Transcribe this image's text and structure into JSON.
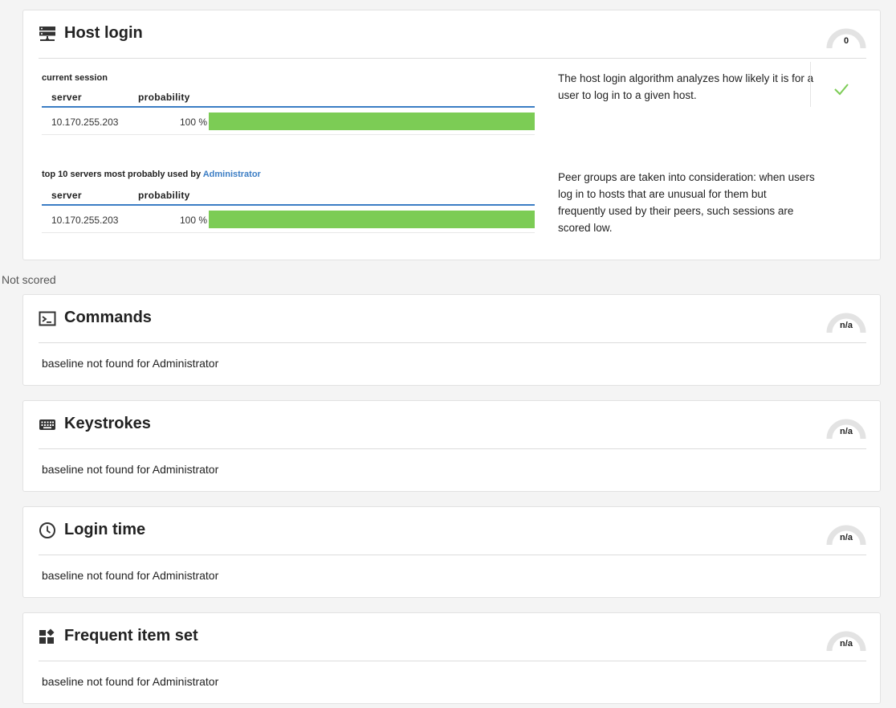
{
  "host_login": {
    "title": "Host login",
    "icon": "server-icon",
    "score": "0",
    "current_session": {
      "label": "current session",
      "columns": [
        "server",
        "probability"
      ],
      "rows": [
        {
          "server": "10.170.255.203",
          "probability": "100 %",
          "fill": 1.0
        }
      ]
    },
    "top_servers": {
      "label_prefix": "top 10 servers most probably used by ",
      "user": "Administrator",
      "columns": [
        "server",
        "probability"
      ],
      "rows": [
        {
          "server": "10.170.255.203",
          "probability": "100 %",
          "fill": 1.0
        }
      ]
    },
    "description_1": "The host login algorithm analyzes how likely it is for a user to log in to a given host.",
    "description_2": "Peer groups are taken into consideration: when users log in to hosts that are unusual for them but frequently used by their peers, such sessions are scored low.",
    "status_icon": "check-icon"
  },
  "section_label": "Not scored",
  "unscored_cards": [
    {
      "title": "Commands",
      "icon": "terminal-icon",
      "score": "n/a",
      "message": "baseline not found for Administrator"
    },
    {
      "title": "Keystrokes",
      "icon": "keyboard-icon",
      "score": "n/a",
      "message": "baseline not found for Administrator"
    },
    {
      "title": "Login time",
      "icon": "clock-icon",
      "score": "n/a",
      "message": "baseline not found for Administrator"
    },
    {
      "title": "Frequent item set",
      "icon": "widgets-icon",
      "score": "n/a",
      "message": "baseline not found for Administrator"
    }
  ],
  "colors": {
    "accent": "#3b7dc4",
    "bar_fill": "#7ccc55",
    "check": "#7ccc55",
    "gauge_track": "#e3e3e3"
  }
}
